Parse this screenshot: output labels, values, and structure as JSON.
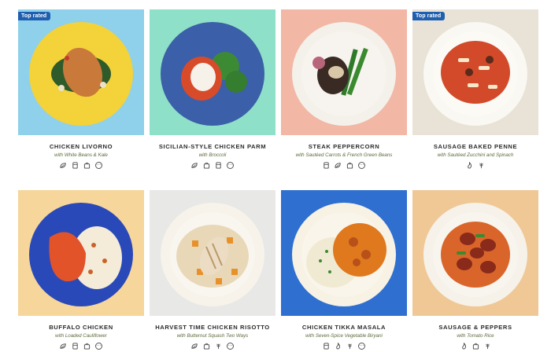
{
  "meals": [
    {
      "name": "CHICKEN LIVORNO",
      "sub": "with White Beans & Kale",
      "badge": "Top rated",
      "bg": "#8fd0ea",
      "plate": "#f3d23a",
      "icons": [
        "leaf-icon",
        "fridge-icon",
        "bag-icon",
        "more-icon"
      ]
    },
    {
      "name": "SICILIAN-STYLE CHICKEN PARM",
      "sub": "with Broccoli",
      "badge": "",
      "bg": "#8fe0c8",
      "plate": "#3b5fa8",
      "icons": [
        "leaf-icon",
        "bag-icon",
        "fridge-icon",
        "more-icon"
      ]
    },
    {
      "name": "STEAK PEPPERCORN",
      "sub": "with Sautéed Carrots & French Green Beans",
      "badge": "",
      "bg": "#f2b7a5",
      "plate": "#f4f1ea",
      "icons": [
        "fridge-icon",
        "leaf-icon",
        "bag-icon",
        "more-icon"
      ]
    },
    {
      "name": "SAUSAGE BAKED PENNE",
      "sub": "with Sautéed Zucchini and Spinach",
      "badge": "Top rated",
      "bg": "#e9e2d6",
      "plate": "#faf8f2",
      "icons": [
        "flame-icon",
        "wheat-icon"
      ]
    },
    {
      "name": "BUFFALO CHICKEN",
      "sub": "with Loaded Cauliflower",
      "badge": "",
      "bg": "#f6d69a",
      "plate": "#2a49b8",
      "icons": [
        "leaf-icon",
        "fridge-icon",
        "bag-icon",
        "more-icon"
      ]
    },
    {
      "name": "HARVEST TIME CHICKEN RISOTTO",
      "sub": "with Butternut Squash Two Ways",
      "badge": "",
      "bg": "#e8e8e6",
      "plate": "#f7f3ea",
      "icons": [
        "leaf-icon",
        "bag-icon",
        "wheat-icon",
        "more-icon"
      ]
    },
    {
      "name": "CHICKEN TIKKA MASALA",
      "sub": "with Seven-Spice Vegetable Biryani",
      "badge": "",
      "bg": "#2f6fd0",
      "plate": "#f7f2e4",
      "icons": [
        "fridge-icon",
        "flame-icon",
        "wheat-icon",
        "more-icon"
      ]
    },
    {
      "name": "SAUSAGE & PEPPERS",
      "sub": "with Tomato Rice",
      "badge": "",
      "bg": "#f0c896",
      "plate": "#f6f2ea",
      "icons": [
        "flame-icon",
        "bag-icon",
        "wheat-icon"
      ]
    }
  ]
}
